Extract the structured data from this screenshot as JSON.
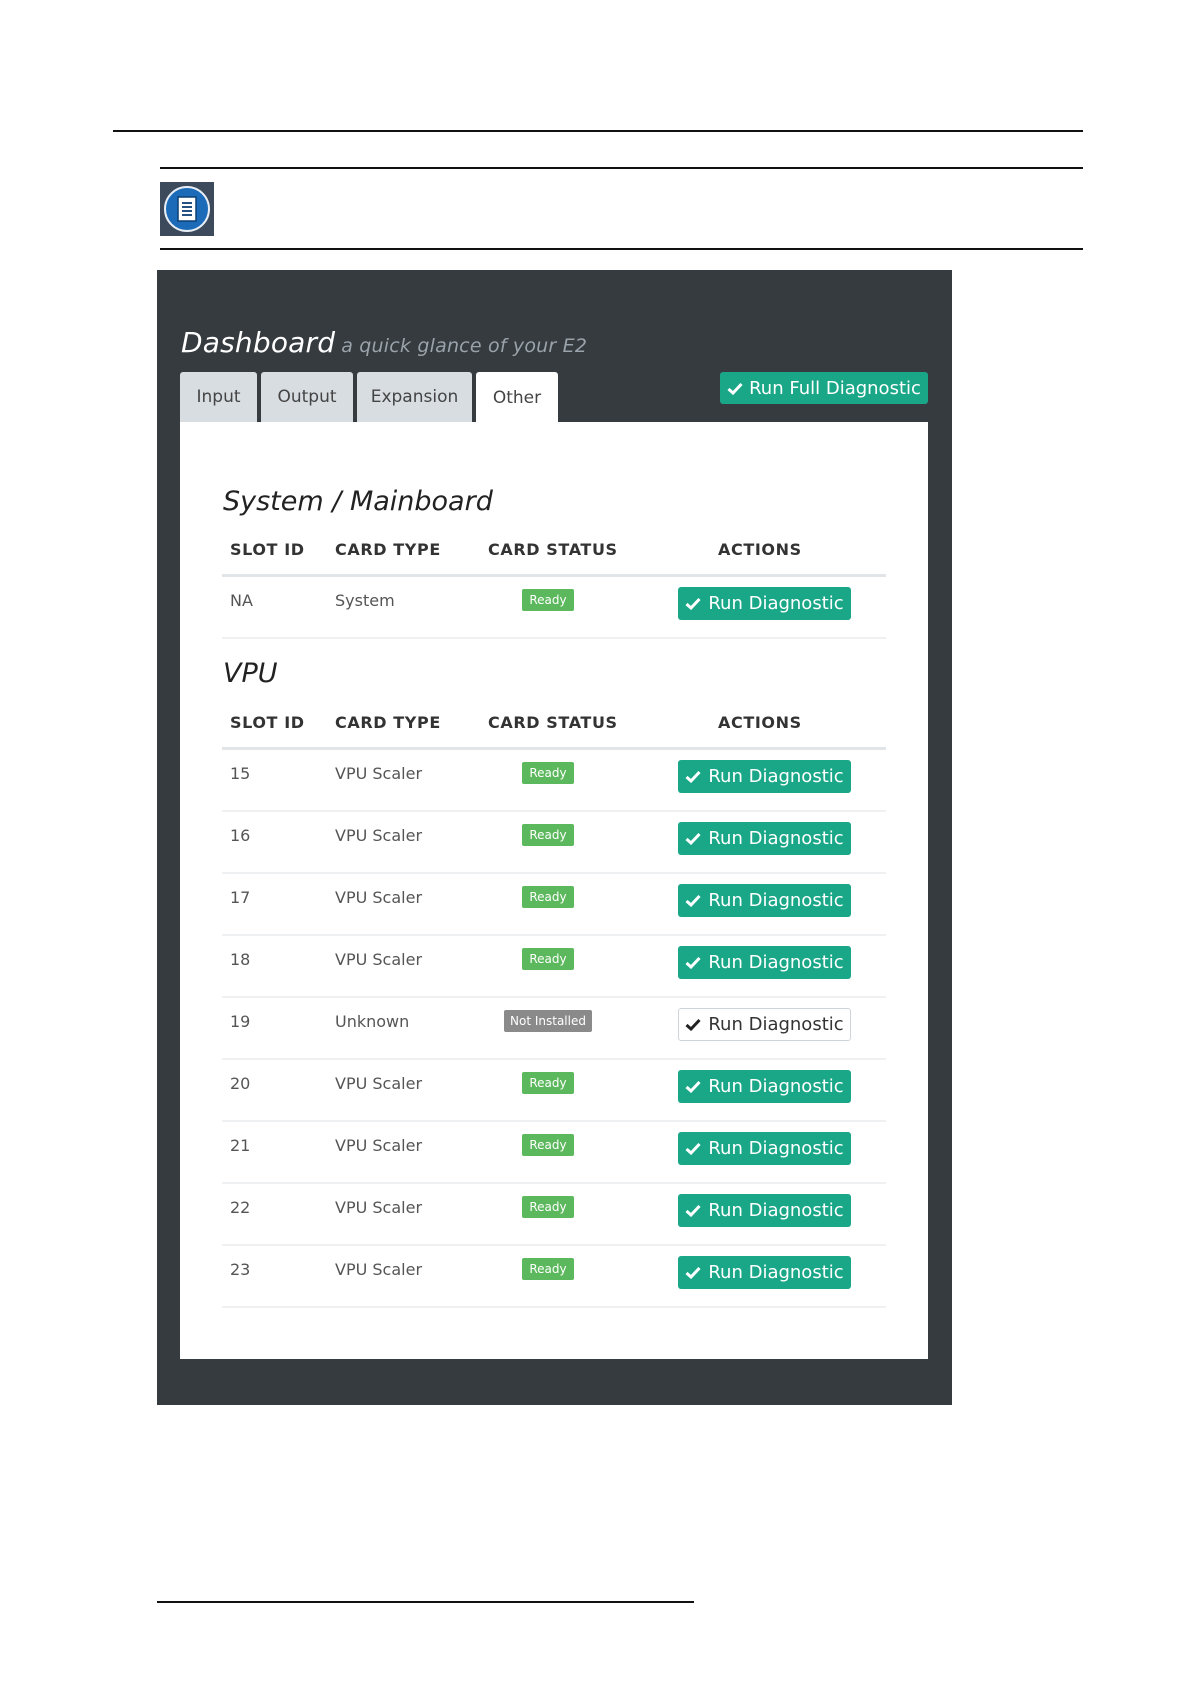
{
  "dashboard": {
    "title": "Dashboard",
    "subtitle": "a quick glance of your E2",
    "full_diagnostic_label": "Run Full Diagnostic"
  },
  "tabs": [
    {
      "label": "Input"
    },
    {
      "label": "Output"
    },
    {
      "label": "Expansion"
    },
    {
      "label": "Other"
    }
  ],
  "active_tab": "Other",
  "columns": {
    "slot_id": "SLOT ID",
    "card_type": "CARD TYPE",
    "card_status": "CARD STATUS",
    "actions": "ACTIONS"
  },
  "system_section": {
    "title": "System / Mainboard",
    "rows": [
      {
        "slot": "NA",
        "type": "System",
        "status": "Ready",
        "action": "Run Diagnostic"
      }
    ]
  },
  "vpu_section": {
    "title": "VPU",
    "rows": [
      {
        "slot": "15",
        "type": "VPU Scaler",
        "status": "Ready",
        "action": "Run Diagnostic"
      },
      {
        "slot": "16",
        "type": "VPU Scaler",
        "status": "Ready",
        "action": "Run Diagnostic"
      },
      {
        "slot": "17",
        "type": "VPU Scaler",
        "status": "Ready",
        "action": "Run Diagnostic"
      },
      {
        "slot": "18",
        "type": "VPU Scaler",
        "status": "Ready",
        "action": "Run Diagnostic"
      },
      {
        "slot": "19",
        "type": "Unknown",
        "status": "Not Installed",
        "action": "Run Diagnostic"
      },
      {
        "slot": "20",
        "type": "VPU Scaler",
        "status": "Ready",
        "action": "Run Diagnostic"
      },
      {
        "slot": "21",
        "type": "VPU Scaler",
        "status": "Ready",
        "action": "Run Diagnostic"
      },
      {
        "slot": "22",
        "type": "VPU Scaler",
        "status": "Ready",
        "action": "Run Diagnostic"
      },
      {
        "slot": "23",
        "type": "VPU Scaler",
        "status": "Ready",
        "action": "Run Diagnostic"
      }
    ]
  },
  "colors": {
    "frame": "#363b40",
    "accent_green": "#1aa788",
    "ready_badge": "#5cb85c",
    "not_installed_badge": "#8a8a8a"
  },
  "icons": {
    "note": "note-document-icon",
    "check": "check-icon"
  }
}
